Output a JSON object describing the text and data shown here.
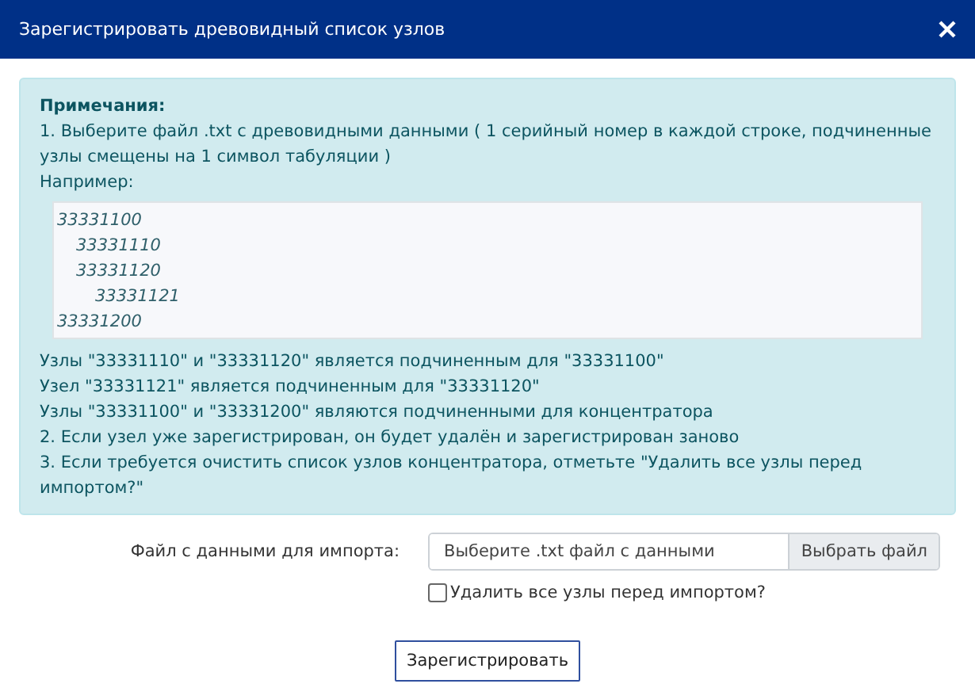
{
  "window": {
    "title": "Зарегистрировать древовидный список узлов"
  },
  "notes": {
    "heading": "Примечания:",
    "intro": [
      "1. Выберите файл .txt с древовидными данными ( 1 серийный номер в каждой строке, подчиненные узлы смещены на 1 символ табуляции )",
      "Например:"
    ],
    "example": [
      {
        "text": "33331100",
        "children": [
          {
            "text": "33331110"
          },
          {
            "text": "33331120",
            "children": [
              {
                "text": "33331121"
              }
            ]
          }
        ]
      },
      {
        "text": "33331200"
      }
    ],
    "lines": [
      "Узлы \"33331110\" и \"33331120\" является подчиненным для \"33331100\"",
      "Узел \"33331121\" является подчиненным для \"33331120\"",
      "Узлы \"33331100\" и \"33331200\" являются подчиненными для концентратора",
      "2. Если узел уже зарегистрирован, он будет удалён и зарегистрирован заново",
      "3. Если требуется очистить список узлов концентратора, отметьте \"Удалить все узлы перед импортом?\""
    ]
  },
  "file": {
    "label": "Файл с данными для импорта:",
    "placeholder": "Выберите .txt файл с данными",
    "browse": "Выбрать файл"
  },
  "delete_all": {
    "label": "Удалить все узлы перед импортом?",
    "checked": false
  },
  "submit": "Зарегистрировать"
}
